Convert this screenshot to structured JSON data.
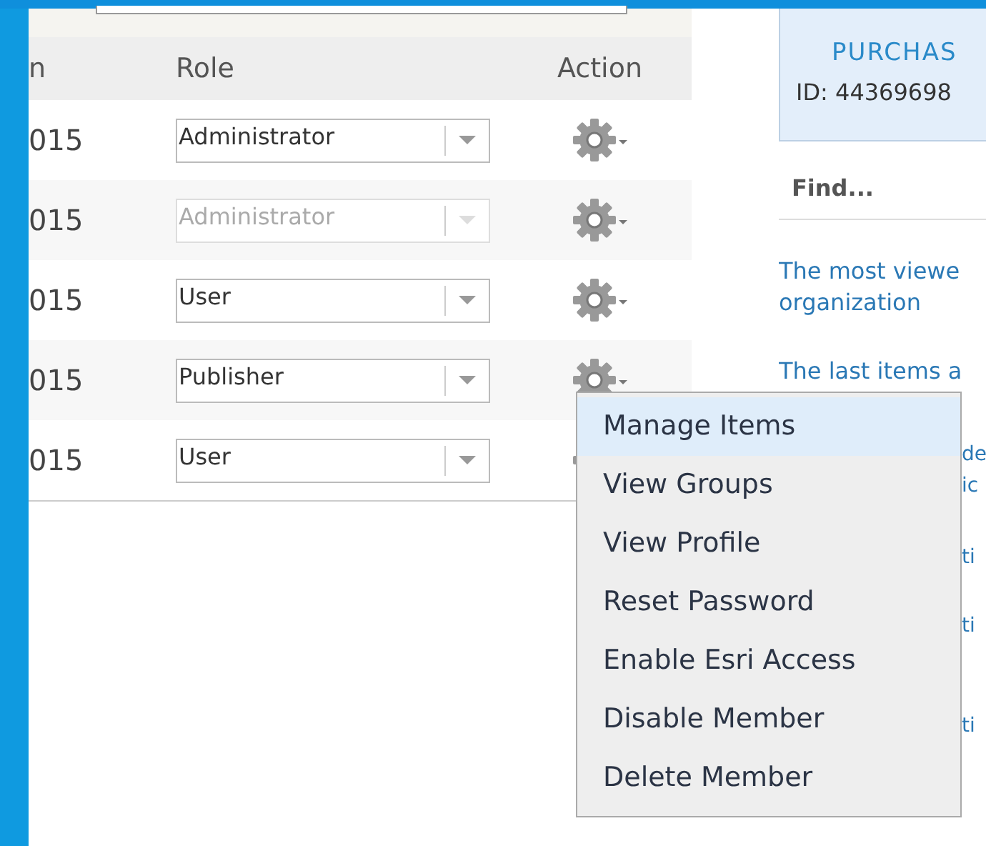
{
  "table": {
    "columns": [
      {
        "label": "n"
      },
      {
        "label": "Role"
      },
      {
        "label": "Action"
      }
    ],
    "rows": [
      {
        "date": "015",
        "role": "Administrator",
        "disabled": false
      },
      {
        "date": "015",
        "role": "Administrator",
        "disabled": true
      },
      {
        "date": "015",
        "role": "User",
        "disabled": false
      },
      {
        "date": "015",
        "role": "Publisher",
        "disabled": false
      },
      {
        "date": "015",
        "role": "User",
        "disabled": false
      }
    ]
  },
  "license_box": {
    "link": "PURCHAS",
    "id": "ID: 44369698"
  },
  "find": {
    "title": "Find...",
    "links": [
      {
        "lines": [
          "The most viewe",
          "organization"
        ]
      },
      {
        "lines": [
          "The last items a"
        ]
      }
    ],
    "covered_fragments": [
      {
        "lines": [
          "de",
          "ic"
        ]
      },
      {
        "lines": [
          "ti"
        ]
      },
      {
        "lines": [
          "ti"
        ]
      },
      {
        "lines": [
          "ti"
        ]
      }
    ]
  },
  "action_menu": {
    "items": [
      {
        "label": "Manage Items",
        "selected": true
      },
      {
        "label": "View Groups",
        "selected": false
      },
      {
        "label": "View Profile",
        "selected": false
      },
      {
        "label": "Reset Password",
        "selected": false
      },
      {
        "label": "Enable Esri Access",
        "selected": false
      },
      {
        "label": "Disable Member",
        "selected": false
      },
      {
        "label": "Delete Member",
        "selected": false
      }
    ]
  }
}
